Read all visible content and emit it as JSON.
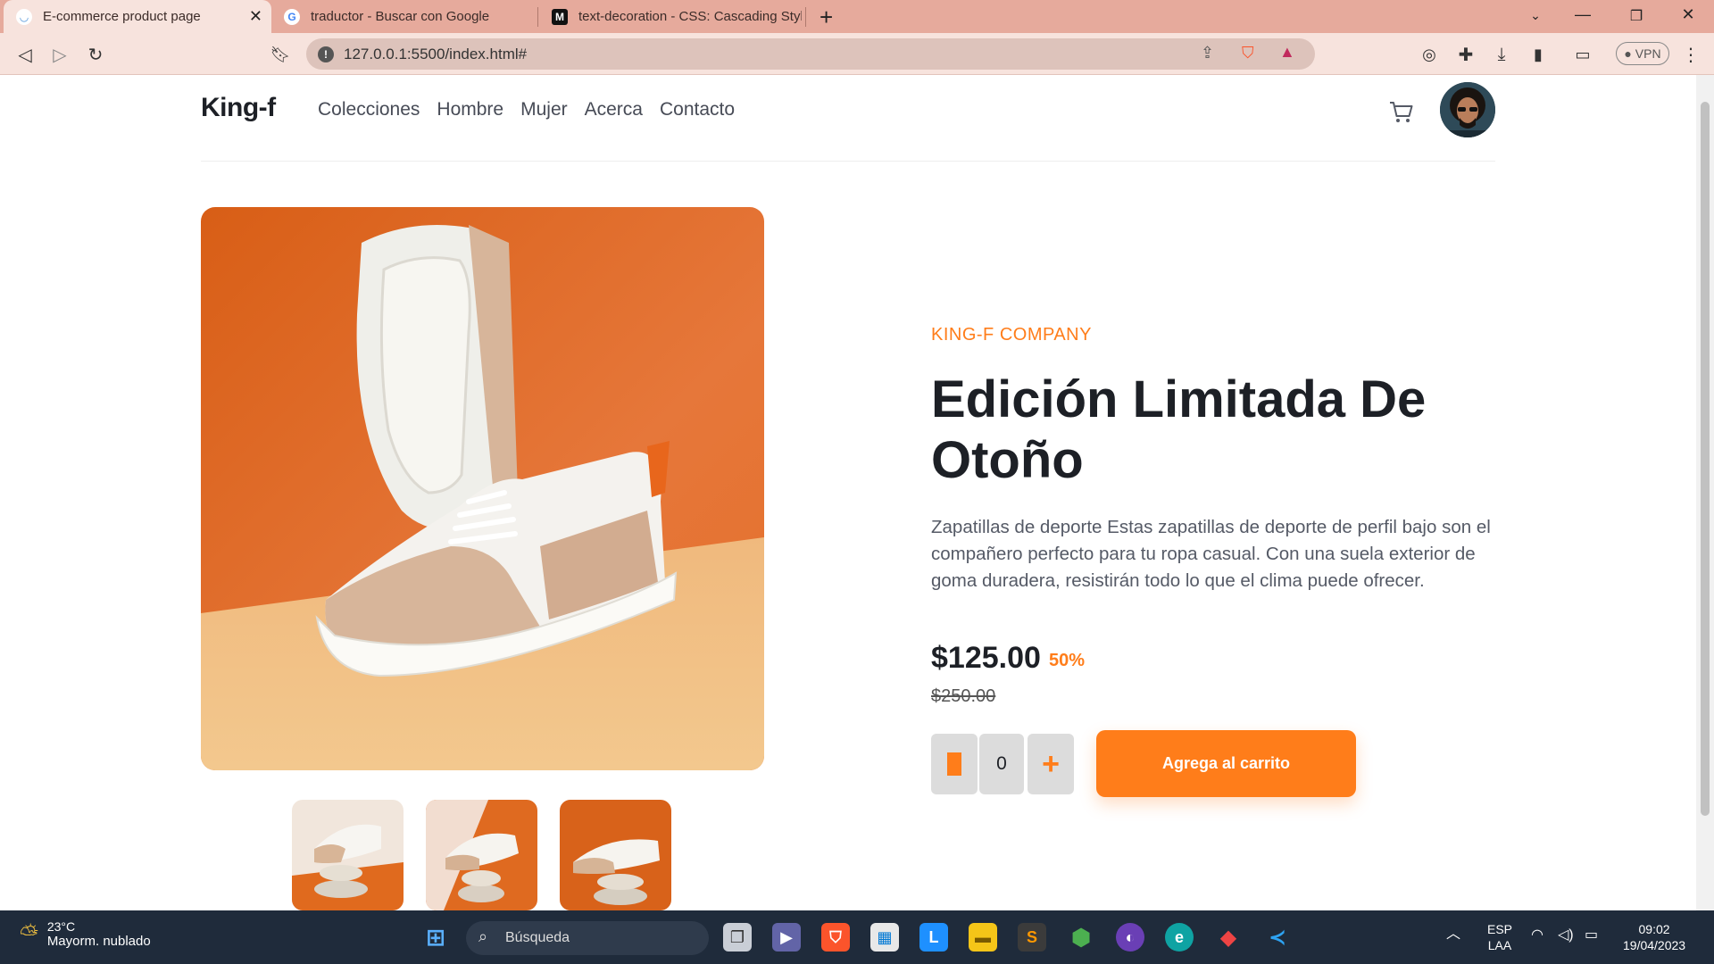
{
  "browser": {
    "tabs": [
      {
        "title": "E-commerce product page",
        "active": true
      },
      {
        "title": "traductor - Buscar con Google",
        "active": false
      },
      {
        "title": "text-decoration - CSS: Cascading Style",
        "active": false
      }
    ],
    "url": "127.0.0.1:5500/index.html#",
    "vpn_label": "VPN"
  },
  "site": {
    "logo": "King-f",
    "nav": [
      "Colecciones",
      "Hombre",
      "Mujer",
      "Acerca",
      "Contacto"
    ]
  },
  "product": {
    "company": "KING-F COMPANY",
    "title": "Edición Limitada De Otoño",
    "description": "Zapatillas de deporte Estas zapatillas de deporte de perfil bajo son el compañero perfecto para tu ropa casual. Con una suela exterior de goma duradera, resistirán todo lo que el clima puede ofrecer.",
    "price": "$125.00",
    "discount": "50%",
    "old_price": "$250.00",
    "quantity": "0",
    "add_to_cart": "Agrega al carrito"
  },
  "taskbar": {
    "weather_temp": "23°C",
    "weather_desc": "Mayorm. nublado",
    "search_label": "Búsqueda",
    "lang_1": "ESP",
    "lang_2": "LAA",
    "time": "09:02",
    "date": "19/04/2023"
  },
  "colors": {
    "accent": "#ff7d1a",
    "tabbar": "#e6aa9c",
    "toolbar": "#f7e3dd",
    "taskbar": "#1f2b3b"
  }
}
